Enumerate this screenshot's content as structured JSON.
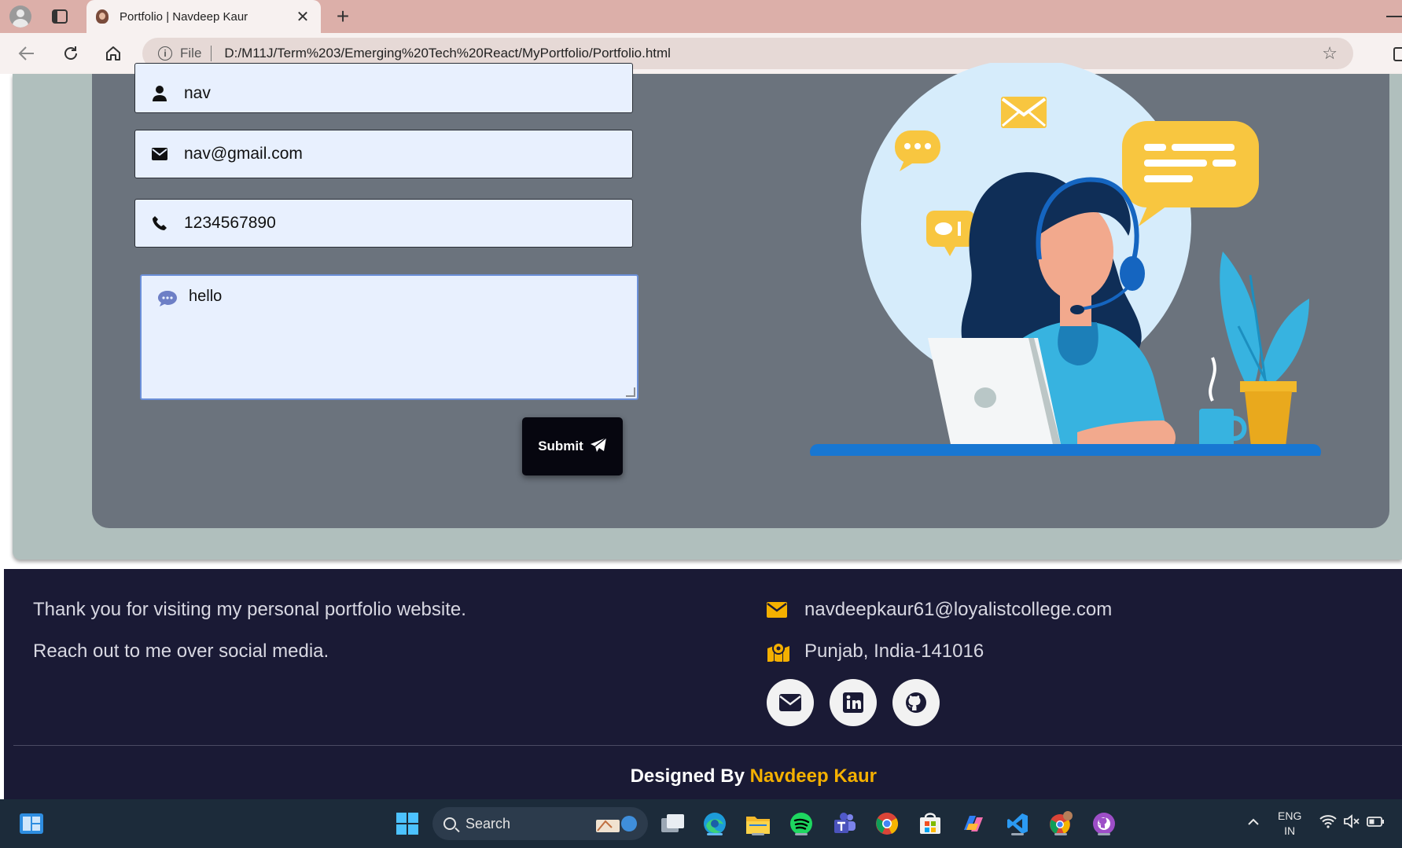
{
  "browser": {
    "tab_title": "Portfolio | Navdeep Kaur",
    "tab_close": "✕",
    "new_tab": "+",
    "scheme": "File",
    "url": "D:/M11J/Term%203/Emerging%20Tech%20React/MyPortfolio/Portfolio.html",
    "info_symbol": "i"
  },
  "form": {
    "name_value": "nav",
    "email_value": "nav@gmail.com",
    "phone_value": "1234567890",
    "message_value": "hello",
    "submit_label": "Submit"
  },
  "footer": {
    "thank_you": "Thank you for visiting my personal portfolio website.",
    "reach_out": "Reach out to me over social media.",
    "email": "navdeepkaur61@loyalistcollege.com",
    "location": "Punjab, India-141016",
    "designed_prefix": "Designed By ",
    "designer_name": "Navdeep Kaur",
    "accent_color": "#f4b000"
  },
  "taskbar": {
    "search_label": "Search",
    "lang_line1": "ENG",
    "lang_line2": "IN"
  },
  "icons": {
    "name_field": "user-icon",
    "email_field": "envelope-icon",
    "phone_field": "phone-icon",
    "message_field": "comment-dots-icon",
    "submit": "paper-plane-icon",
    "footer_email": "envelope-icon",
    "footer_location": "map-location-icon",
    "socials": [
      "envelope-icon",
      "linkedin-icon",
      "github-icon"
    ]
  }
}
